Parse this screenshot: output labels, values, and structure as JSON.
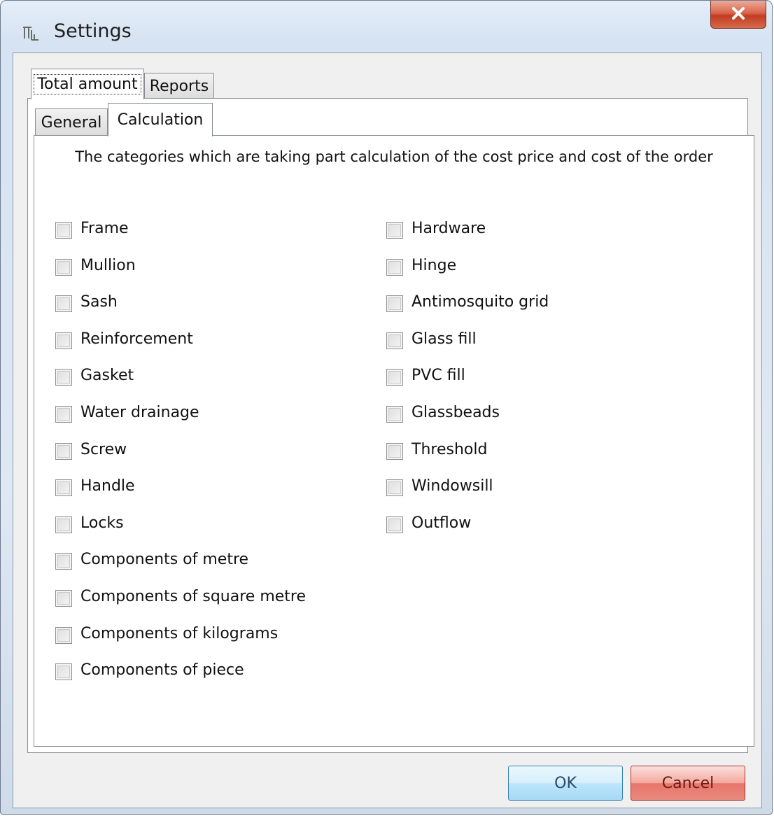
{
  "window": {
    "title": "Settings",
    "icon": "settings-window-icon",
    "close_icon": "close-x-icon"
  },
  "outer_tabs": [
    {
      "label": "Total amount",
      "active": true
    },
    {
      "label": "Reports",
      "active": false
    }
  ],
  "inner_tabs": [
    {
      "label": "General",
      "active": false
    },
    {
      "label": "Calculation",
      "active": true
    }
  ],
  "calculation": {
    "heading": "The categories which are taking part calculation of the cost price and cost of the order",
    "left_items": [
      {
        "label": "Frame",
        "checked": false
      },
      {
        "label": "Mullion",
        "checked": false
      },
      {
        "label": "Sash",
        "checked": false
      },
      {
        "label": "Reinforcement",
        "checked": false
      },
      {
        "label": "Gasket",
        "checked": false
      },
      {
        "label": "Water drainage",
        "checked": false
      },
      {
        "label": "Screw",
        "checked": false
      },
      {
        "label": "Handle",
        "checked": false
      },
      {
        "label": "Locks",
        "checked": false
      },
      {
        "label": "Components of metre",
        "checked": false
      },
      {
        "label": "Components of square metre",
        "checked": false
      },
      {
        "label": "Components of kilograms",
        "checked": false
      },
      {
        "label": "Components of piece",
        "checked": false
      }
    ],
    "right_items": [
      {
        "label": "Hardware",
        "checked": false
      },
      {
        "label": "Hinge",
        "checked": false
      },
      {
        "label": "Antimosquito grid",
        "checked": false
      },
      {
        "label": "Glass fill",
        "checked": false
      },
      {
        "label": "PVC fill",
        "checked": false
      },
      {
        "label": "Glassbeads",
        "checked": false
      },
      {
        "label": "Threshold",
        "checked": false
      },
      {
        "label": "Windowsill",
        "checked": false
      },
      {
        "label": "Outflow",
        "checked": false
      }
    ]
  },
  "buttons": {
    "ok": "OK",
    "cancel": "Cancel"
  },
  "colors": {
    "close_button": "#c8452b",
    "ok_button": "#bde6fd",
    "cancel_button": "#e8756a"
  }
}
